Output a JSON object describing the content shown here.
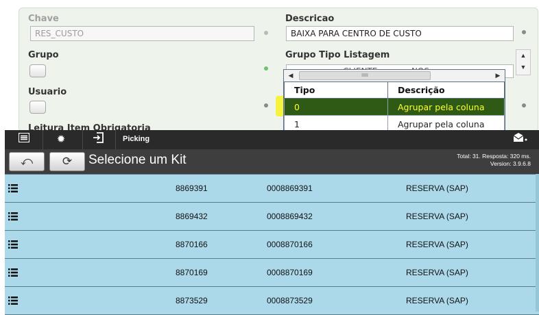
{
  "form": {
    "chave_label": "Chave",
    "chave_value": "RES_CUSTO",
    "descricao_label": "Descricao",
    "descricao_value": "BAIXA PARA CENTRO DE CUSTO",
    "grupo_label": "Grupo",
    "grupo_tipo_label": "Grupo Tipo Listagem",
    "grupo_tipo_value": "... ... ... ... ... CLIENTE ... ... ... NOS",
    "usuario_label": "Usuario",
    "leitura_label": "Leitura Item Obrigatoria"
  },
  "dropdown": {
    "columns": [
      "Tipo",
      "Descrição"
    ],
    "rows": [
      {
        "tipo": "0",
        "descricao": "Agrupar pela coluna",
        "selected": true
      },
      {
        "tipo": "1",
        "descricao": "Agrupar pela coluna",
        "selected": false
      }
    ],
    "scroll_thumb": "IIIII"
  },
  "app": {
    "title": "Picking",
    "subtitle": "Selecione um Kit",
    "stats_line1": "Total: 31. Resposta: 320 ms.",
    "stats_line2": "Version: 3.9.6.8",
    "icons": [
      "menu-icon",
      "gear-icon",
      "exit-icon",
      "notification-icon",
      "back-icon",
      "refresh-icon",
      "list-icon"
    ],
    "colors": {
      "row_bg": "#acd9ea",
      "topbar": "#2a2a2a",
      "selected_row": "#2f5a16",
      "selected_text": "#ffff2a"
    }
  },
  "kits": [
    {
      "code": "8869391",
      "full_code": "0008869391",
      "type": "RESERVA (SAP)"
    },
    {
      "code": "8869432",
      "full_code": "0008869432",
      "type": "RESERVA (SAP)"
    },
    {
      "code": "8870166",
      "full_code": "0008870166",
      "type": "RESERVA (SAP)"
    },
    {
      "code": "8870169",
      "full_code": "0008870169",
      "type": "RESERVA (SAP)"
    },
    {
      "code": "8873529",
      "full_code": "0008873529",
      "type": "RESERVA (SAP)"
    }
  ]
}
